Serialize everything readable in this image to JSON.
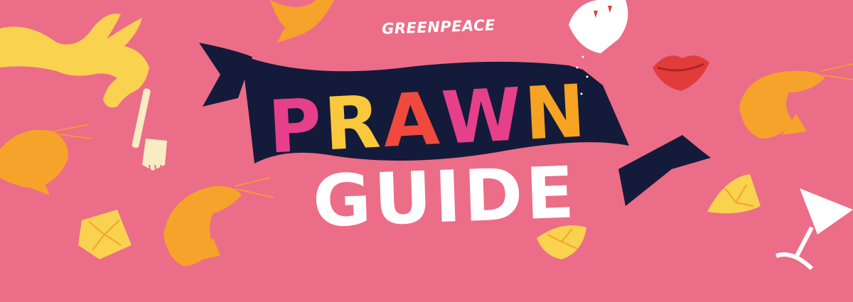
{
  "brand": {
    "name": "GREENPEACE"
  },
  "title": {
    "letters": [
      {
        "char": "P",
        "color": "#e6408a"
      },
      {
        "char": "R",
        "color": "#f9c83d"
      },
      {
        "char": "A",
        "color": "#ef4a3d"
      },
      {
        "char": "W",
        "color": "#e6408a"
      },
      {
        "char": "N",
        "color": "#f6a324"
      }
    ]
  },
  "subtitle": "GUIDE",
  "colors": {
    "background": "#ec6d87",
    "ribbon": "#141a3a",
    "prawn": "#f5a32a",
    "hand": "#f9d24f",
    "lemon": "#f9d24f",
    "lips": "#e13c3c",
    "white": "#ffffff"
  },
  "icons": [
    "hand-icon",
    "fork-icon",
    "prawn-icon",
    "salt-shaker-icon",
    "lips-icon",
    "lemon-slice-icon",
    "martini-glass-icon",
    "ribbon-banner"
  ]
}
